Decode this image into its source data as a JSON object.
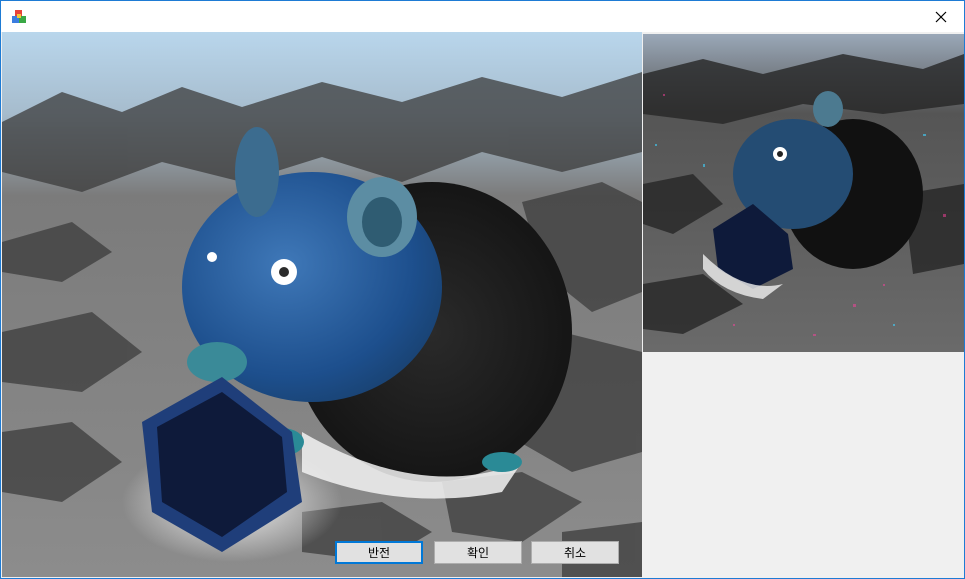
{
  "window": {
    "title": "",
    "close_glyph": "close-icon"
  },
  "buttons": {
    "invert_label": "반전",
    "ok_label": "확인",
    "cancel_label": "취소"
  },
  "colors": {
    "accent": "#0078d7",
    "window_border": "#1e7bd4",
    "button_face": "#e1e1e1",
    "panel_background": "#f0f0f0"
  }
}
